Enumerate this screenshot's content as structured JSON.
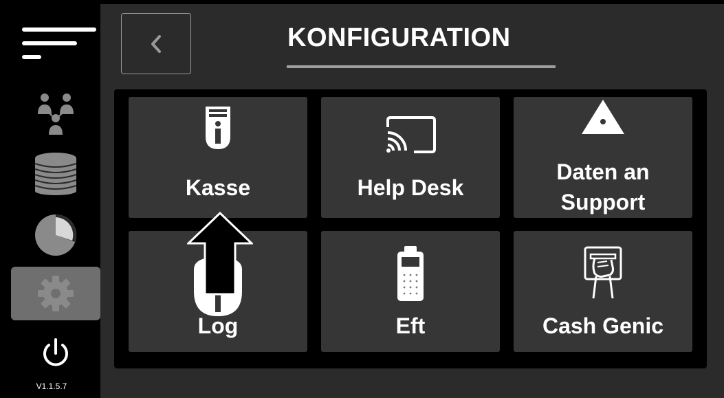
{
  "header": {
    "title": "KONFIGURATION"
  },
  "sidebar": {
    "items": [
      {
        "name": "menu-icon"
      },
      {
        "name": "users-icon"
      },
      {
        "name": "coins-icon"
      },
      {
        "name": "pie-chart-icon"
      },
      {
        "name": "gear-icon",
        "active": true
      },
      {
        "name": "power-icon"
      }
    ],
    "version": "V1.1.5.7"
  },
  "tiles": [
    {
      "label": "Kasse",
      "icon": "receipt-info-icon"
    },
    {
      "label": "Help Desk",
      "icon": "cast-icon"
    },
    {
      "label_line1": "Daten an",
      "label_line2": "Support",
      "icon": "upload-logo-icon"
    },
    {
      "label": "Log",
      "icon": "log-info-icon"
    },
    {
      "label": "Eft",
      "icon": "payment-terminal-icon"
    },
    {
      "label": "Cash Genic",
      "icon": "cash-machine-icon"
    }
  ],
  "colors": {
    "background": "#2b2b2b",
    "tile": "#363636",
    "sidebar": "#000000",
    "active_item": "#6f6f6f",
    "inactive_icon": "#8a8a8a"
  }
}
